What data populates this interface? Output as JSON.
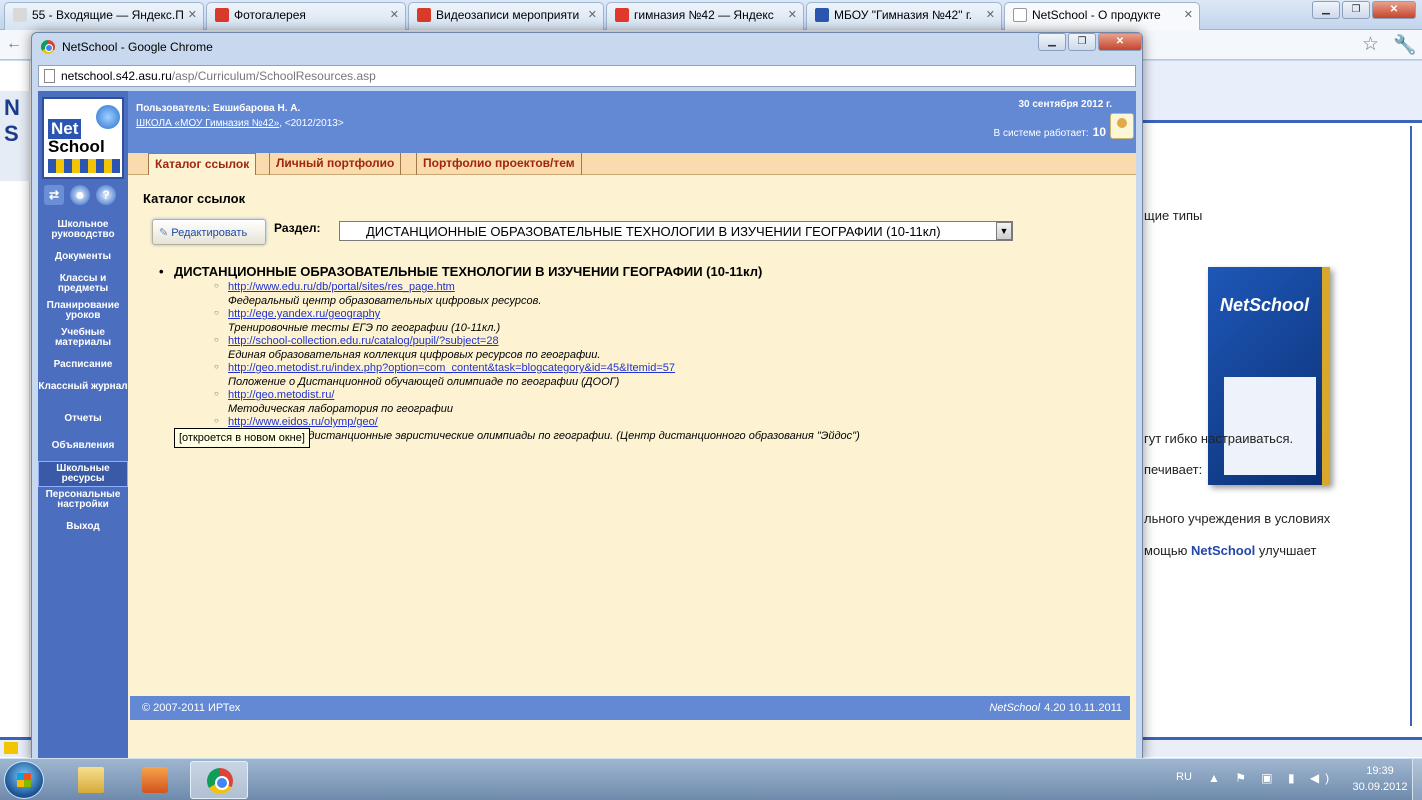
{
  "background_browser": {
    "tabs": [
      {
        "label": "55 - Входящие — Яндекс.П",
        "favicon_color": "#d9d9d9"
      },
      {
        "label": "Фотогалерея",
        "favicon_color": "#d93a2b"
      },
      {
        "label": "Видеозаписи мероприяти",
        "favicon_color": "#d93a2b"
      },
      {
        "label": "гимназия №42 — Яндекс",
        "favicon_color": "#e0392b"
      },
      {
        "label": "МБОУ \"Гимназия №42\" г.",
        "favicon_color": "#2b56b0"
      },
      {
        "label": "NetSchool - О продукте",
        "favicon_color": "#ffffff"
      }
    ],
    "page_fragments": {
      "line1": "щие  типы",
      "line2": "гут гибко настраиваться.",
      "line3": "печивает:",
      "line4": "льного учреждения в условиях",
      "line5_pre": "мощью ",
      "line5_brand": "NetSchool",
      "line5_post": "  улучшает",
      "box_title": "NetSchool",
      "left_logo": "N S"
    }
  },
  "popup": {
    "title": "NetSchool - Google Chrome",
    "url_host": "netschool.s42.asu.ru",
    "url_path": "/asp/Curriculum/SchoolResources.asp"
  },
  "netschool": {
    "logo_net": "Net",
    "logo_school": "School",
    "nav_icons": {
      "map": "⇄",
      "users": "☻",
      "help": "?"
    },
    "nav_items": [
      "Школьное руководство",
      "Документы",
      "Классы и предметы",
      "Планирование уроков",
      "Учебные материалы",
      "Расписание",
      "Классный журнал",
      "Отчеты",
      "Объявления",
      "Школьные ресурсы",
      "Персональные настройки",
      "Выход"
    ],
    "active_nav_index": 9,
    "header": {
      "user": "Пользователь: Екшибарова Н. А.",
      "school_link": "ШКОЛА «МОУ Гимназия №42»",
      "school_suffix": ",  <2012/2013>",
      "date": "30 сентября 2012 г.",
      "online_label": "В системе работает:",
      "online_count": "10"
    },
    "tabs": [
      "Каталог ссылок",
      "Личный портфолио",
      "Портфолио проектов/тем"
    ],
    "active_tab": 0,
    "heading": "Каталог ссылок",
    "edit_button": "Редактировать",
    "section_label": "Раздел:",
    "section_value": "ДИСТАНЦИОННЫЕ ОБРАЗОВАТЕЛЬНЫЕ ТЕХНОЛОГИИ В ИЗУЧЕНИИ ГЕОГРАФИИ (10-11кл)",
    "resource_title": "ДИСТАНЦИОННЫЕ ОБРАЗОВАТЕЛЬНЫЕ ТЕХНОЛОГИИ В ИЗУЧЕНИИ ГЕОГРАФИИ (10-11кл)",
    "resources": [
      {
        "url": "http://www.edu.ru/db/portal/sites/res_page.htm",
        "desc": "Федеральный центр образовательных цифровых ресурсов."
      },
      {
        "url": "http://ege.yandex.ru/geography",
        "desc": "Тренировочные тесты ЕГЭ по географии (10-11кл.)"
      },
      {
        "url": "http://school-collection.edu.ru/catalog/pupil/?subject=28",
        "desc": "Единая образовательная коллекция цифровых ресурсов по географии."
      },
      {
        "url": "http://geo.metodist.ru/index.php?option=com_content&task=blogcategory&id=45&Itemid=57",
        "desc": "Положение о Дистанционной обучающей олимпиаде по географии (ДООГ)"
      },
      {
        "url": "http://geo.metodist.ru/",
        "desc": "Методическая лаборатория по географии"
      },
      {
        "url": "http://www.eidos.ru/olymp/geo/",
        "desc": "Всероссийские дистанционные эвристические олимпиады по географии. (Центр дистанционного образования \"Эйдос\")"
      }
    ],
    "tooltip": "[откроется в новом окне]",
    "footer_copyright": "© 2007-2011 ИРТех",
    "footer_product": "NetSchool",
    "footer_version": "4.20   10.11.2011"
  },
  "taskbar": {
    "lang": "RU",
    "time": "19:39",
    "date": "30.09.2012",
    "tray_icons": "▲ ⚑ ▣ ▮ ◀)"
  }
}
